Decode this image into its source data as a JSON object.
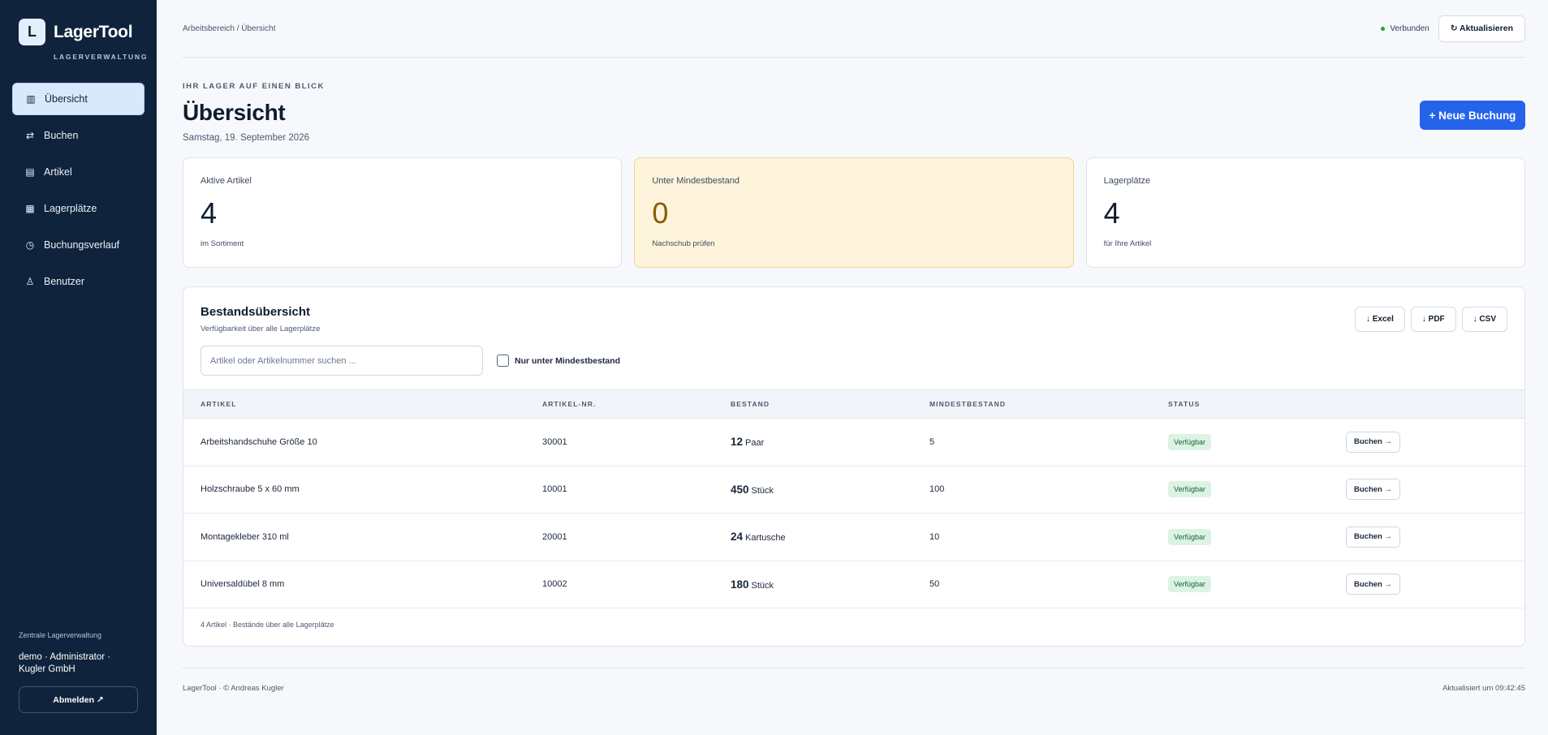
{
  "brand": {
    "logo": "L",
    "name": "LagerTool",
    "subtitle": "LAGERVERWALTUNG"
  },
  "nav": [
    {
      "icon": "▥",
      "label": "Übersicht",
      "active": true
    },
    {
      "icon": "⇄",
      "label": "Buchen"
    },
    {
      "icon": "▤",
      "label": "Artikel"
    },
    {
      "icon": "▦",
      "label": "Lagerplätze"
    },
    {
      "icon": "◷",
      "label": "Buchungsverlauf"
    },
    {
      "icon": "♙",
      "label": "Benutzer"
    }
  ],
  "sidebar_footer": {
    "org": "Zentrale Lagerverwaltung",
    "user": "demo · Administrator · Kugler GmbH",
    "logout": "Abmelden ↗"
  },
  "topbar": {
    "breadcrumb": "Arbeitsbereich / Übersicht",
    "status": "Verbunden",
    "refresh": "↻ Aktualisieren"
  },
  "header": {
    "kicker": "IHR LAGER AUF EINEN BLICK",
    "title": "Übersicht",
    "date": "Samstag, 19. September 2026",
    "new_booking": "+ Neue Buchung"
  },
  "cards": [
    {
      "label": "Aktive Artikel",
      "value": "4",
      "sub": "im Sortiment"
    },
    {
      "label": "Unter Mindestbestand",
      "value": "0",
      "sub": "Nachschub prüfen"
    },
    {
      "label": "Lagerplätze",
      "value": "4",
      "sub": "für Ihre Artikel"
    }
  ],
  "inventory": {
    "title": "Bestandsübersicht",
    "subtitle": "Verfügbarkeit über alle Lagerplätze",
    "exports": [
      "↓ Excel",
      "↓ PDF",
      "↓ CSV"
    ],
    "search_placeholder": "Artikel oder Artikelnummer suchen ...",
    "filter_label": "Nur unter Mindestbestand",
    "columns": [
      "ARTIKEL",
      "ARTIKEL-NR.",
      "BESTAND",
      "MINDESTBESTAND",
      "STATUS",
      ""
    ],
    "rows": [
      {
        "name": "Arbeitshandschuhe Größe 10",
        "number": "30001",
        "qty": "12",
        "unit": "Paar",
        "min": "5",
        "status": "Verfügbar",
        "action": "Buchen →"
      },
      {
        "name": "Holzschraube 5 x 60 mm",
        "number": "10001",
        "qty": "450",
        "unit": "Stück",
        "min": "100",
        "status": "Verfügbar",
        "action": "Buchen →"
      },
      {
        "name": "Montagekleber 310 ml",
        "number": "20001",
        "qty": "24",
        "unit": "Kartusche",
        "min": "10",
        "status": "Verfügbar",
        "action": "Buchen →"
      },
      {
        "name": "Universaldübel 8 mm",
        "number": "10002",
        "qty": "180",
        "unit": "Stück",
        "min": "50",
        "status": "Verfügbar",
        "action": "Buchen →"
      }
    ],
    "footer": "4 Artikel · Bestände über alle Lagerplätze"
  },
  "footer": {
    "left": "LagerTool · © Andreas Kugler",
    "right": "Aktualisiert um 09:42:45"
  },
  "colors": {
    "sidebar": "#10233c",
    "accent": "#2563eb",
    "warning_bg": "#fef4dc",
    "success_badge": "#dcf3e4"
  }
}
